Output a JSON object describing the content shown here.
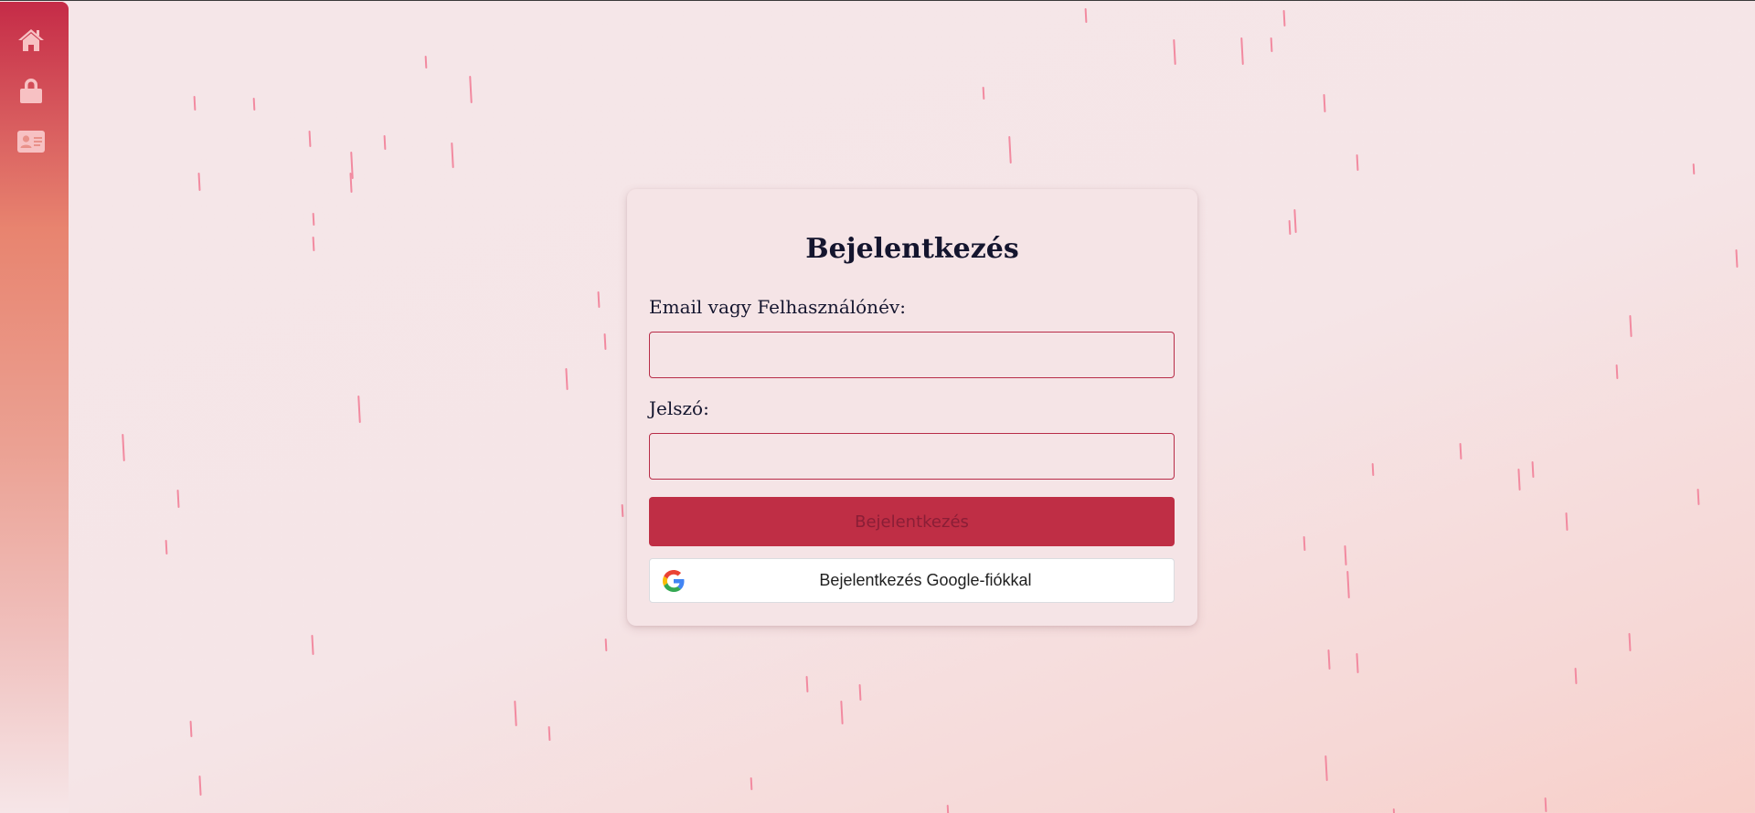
{
  "sidebar": {
    "items": [
      {
        "icon": "home-icon"
      },
      {
        "icon": "lock-icon"
      },
      {
        "icon": "id-card-icon"
      }
    ],
    "icon_color": "#f7c1c3"
  },
  "login": {
    "title": "Bejelentkezés",
    "username_label": "Email vagy Felhasználónév:",
    "username_value": "",
    "password_label": "Jelszó:",
    "password_value": "",
    "submit_label": "Bejelentkezés",
    "google_label": "Bejelentkezés Google-fiókkal",
    "google_icon": "google-logo-icon"
  },
  "colors": {
    "accent": "#bf2e45",
    "text": "#14152e",
    "background": "#f5e6e8",
    "rain": "#f28aa0"
  }
}
